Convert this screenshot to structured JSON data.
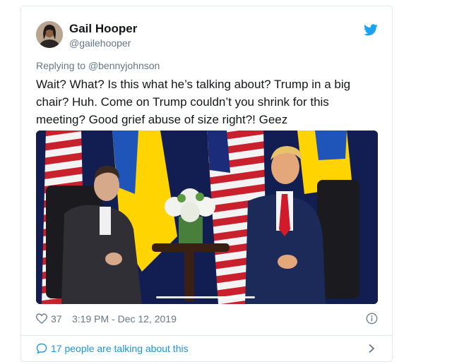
{
  "author": {
    "name": "Gail Hooper",
    "handle": "@gailehooper"
  },
  "reply": {
    "prefix": "Replying to ",
    "mention": "@bennyjohnson"
  },
  "tweet": {
    "text": "Wait?  What? Is this what he’s talking about?  Trump in a big chair?  Huh. Come on Trump couldn’t you shrink for this meeting?  Good grief abuse of size right?!  Geez"
  },
  "meta": {
    "likes": "37",
    "timestamp": "3:19 PM - Dec 12, 2019"
  },
  "footer": {
    "talking": "17 people are talking about this"
  },
  "icons": {
    "brand": "twitter-bird-icon",
    "like": "heart-icon",
    "info": "info-icon",
    "conversation": "speech-bubble-icon",
    "more": "chevron-right-icon"
  },
  "colors": {
    "brand_blue": "#1da1f2",
    "link_blue": "#1b95e0",
    "secondary_text": "#657786",
    "primary_text": "#14171a",
    "border": "#e1e8ed"
  }
}
